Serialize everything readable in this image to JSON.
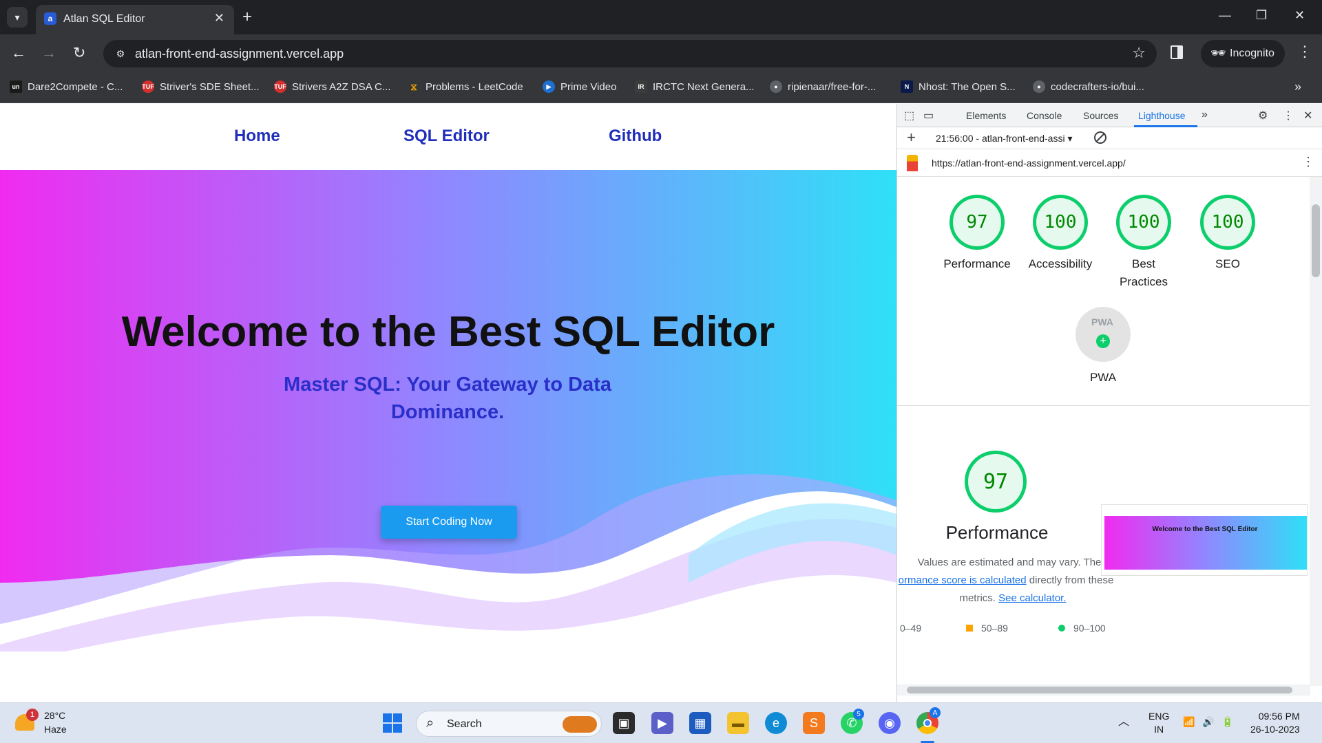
{
  "browser": {
    "tab_title": "Atlan SQL Editor",
    "url": "atlan-front-end-assignment.vercel.app",
    "incognito_label": "Incognito",
    "bookmarks": [
      {
        "label": "Dare2Compete - C...",
        "icon": "un",
        "color": "#1a1a1a"
      },
      {
        "label": "Striver's SDE Sheet...",
        "icon": "TUF",
        "color": "#d32f2f"
      },
      {
        "label": "Strivers A2Z DSA C...",
        "icon": "TUF",
        "color": "#d32f2f"
      },
      {
        "label": "Problems - LeetCode",
        "icon": "LC",
        "color": "#3c3c3c"
      },
      {
        "label": "Prime Video",
        "icon": "▶",
        "color": "#1f6fd0"
      },
      {
        "label": "IRCTC Next Genera...",
        "icon": "IR",
        "color": "#3c3c3c"
      },
      {
        "label": "ripienaar/free-for-...",
        "icon": "GH",
        "color": "#5f6368"
      },
      {
        "label": "Nhost: The Open S...",
        "icon": "N",
        "color": "#0b1a4a"
      },
      {
        "label": "codecrafters-io/bui...",
        "icon": "GH",
        "color": "#5f6368"
      }
    ]
  },
  "site": {
    "nav": [
      "Home",
      "SQL Editor",
      "Github"
    ],
    "hero_title": "Welcome to the Best SQL Editor",
    "hero_subtitle": "Master SQL: Your Gateway to Data Dominance.",
    "cta_label": "Start Coding Now"
  },
  "devtools": {
    "tabs": [
      "Elements",
      "Console",
      "Sources",
      "Lighthouse"
    ],
    "active_tab": "Lighthouse",
    "report_label": "21:56:00 - atlan-front-end-assi",
    "report_url": "https://atlan-front-end-assignment.vercel.app/",
    "scores": [
      {
        "value": "97",
        "label": "Performance"
      },
      {
        "value": "100",
        "label": "Accessibility"
      },
      {
        "value": "100",
        "label": "Best Practices"
      },
      {
        "value": "100",
        "label": "SEO"
      }
    ],
    "pwa_label": "PWA",
    "pwa_badge_text": "PWA",
    "perf_score": "97",
    "perf_title": "Performance",
    "perf_desc_1": "Values are estimated and may vary. The",
    "perf_link_1": "ormance score is calculated",
    "perf_desc_2": "directly from these",
    "perf_desc_3": "metrics.",
    "perf_link_2": "See calculator.",
    "legend": [
      {
        "range": "0–49",
        "color": "#ff4e42"
      },
      {
        "range": "50–89",
        "color": "#ffa400"
      },
      {
        "range": "90–100",
        "color": "#0cce6b"
      }
    ],
    "thumb_title": "Welcome to the Best SQL Editor"
  },
  "taskbar": {
    "weather_temp": "28°C",
    "weather_cond": "Haze",
    "weather_badge": "1",
    "search_label": "Search",
    "whatsapp_badge": "5",
    "lang_1": "ENG",
    "lang_2": "IN",
    "time": "09:56 PM",
    "date": "26-10-2023"
  },
  "colors": {
    "accent": "#1a73e8",
    "nav_link": "#1f2fba",
    "score_green": "#0cce6b"
  }
}
